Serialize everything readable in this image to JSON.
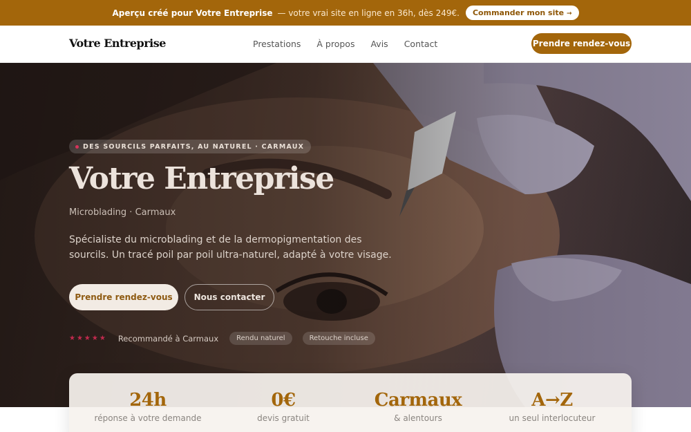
{
  "topbar": {
    "strong": "Aperçu créé pour Votre Entreprise",
    "rest": "— votre vrai site en ligne en 36h, dès 249€.",
    "cta_label": "Commander mon site",
    "cta_arrow": "→"
  },
  "nav": {
    "brand": "Votre Entreprise",
    "links": [
      "Prestations",
      "À propos",
      "Avis",
      "Contact"
    ],
    "cta_label": "Prendre rendez-vous"
  },
  "hero": {
    "tag": "DES SOURCILS PARFAITS, AU NATUREL · CARMAUX",
    "title": "Votre Entreprise",
    "subtitle": "Microblading · Carmaux",
    "description": "Spécialiste du microblading et de la dermopigmentation des sourcils. Un tracé poil par poil ultra-naturel, adapté à votre visage.",
    "primary_button": "Prendre rendez-vous",
    "secondary_button": "Nous contacter",
    "stars": "★★★★★",
    "rating": 5,
    "proof_text": "Recommandé à Carmaux",
    "chips": [
      "Rendu naturel",
      "Retouche incluse"
    ]
  },
  "stats": [
    {
      "value": "24h",
      "label": "réponse à votre demande"
    },
    {
      "value": "0€",
      "label": "devis gratuit"
    },
    {
      "value": "Carmaux",
      "label": "& alentours"
    },
    {
      "value": "A→Z",
      "label": "un seul interlocuteur"
    }
  ],
  "colors": {
    "accent": "#a3660b",
    "star": "#c22a4e",
    "tag_dot": "#d6335a"
  }
}
